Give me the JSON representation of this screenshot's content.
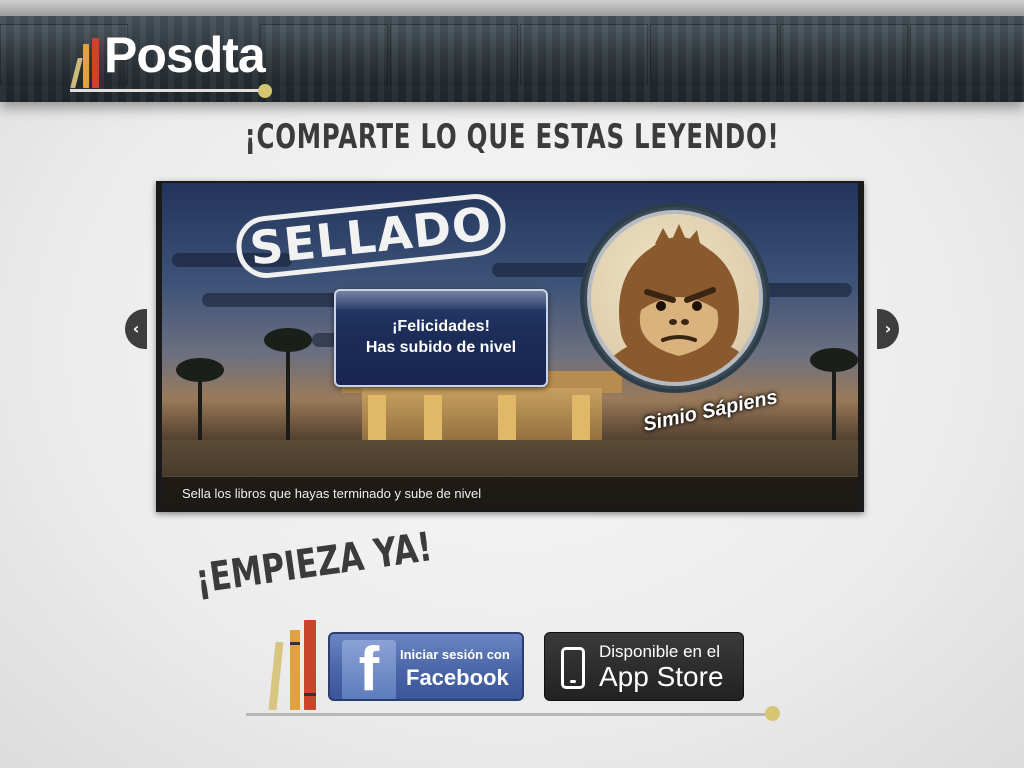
{
  "header": {
    "logo_text": "Posdta"
  },
  "headline": "¡Comparte lo que estas leyendo!",
  "slider": {
    "stamp_text": "SELLADO",
    "popup": {
      "line1": "¡Felicidades!",
      "line2": "Has subido de nivel"
    },
    "badge_caption": "Simio Sápiens",
    "caption": "Sella los libros que hayas terminado y sube de nivel",
    "prev_icon": "chevron-left-icon",
    "next_icon": "chevron-right-icon"
  },
  "start": {
    "title": "¡Empieza ya!",
    "facebook_button": {
      "line1": "Iniciar sesión con",
      "line2": "Facebook"
    },
    "appstore_button": {
      "line1": "Disponible en el",
      "line2": "App Store"
    }
  },
  "colors": {
    "accent_gold": "#d6c571",
    "facebook_blue": "#3b5798",
    "book_orange": "#e2a03e",
    "book_red": "#c8462c"
  }
}
